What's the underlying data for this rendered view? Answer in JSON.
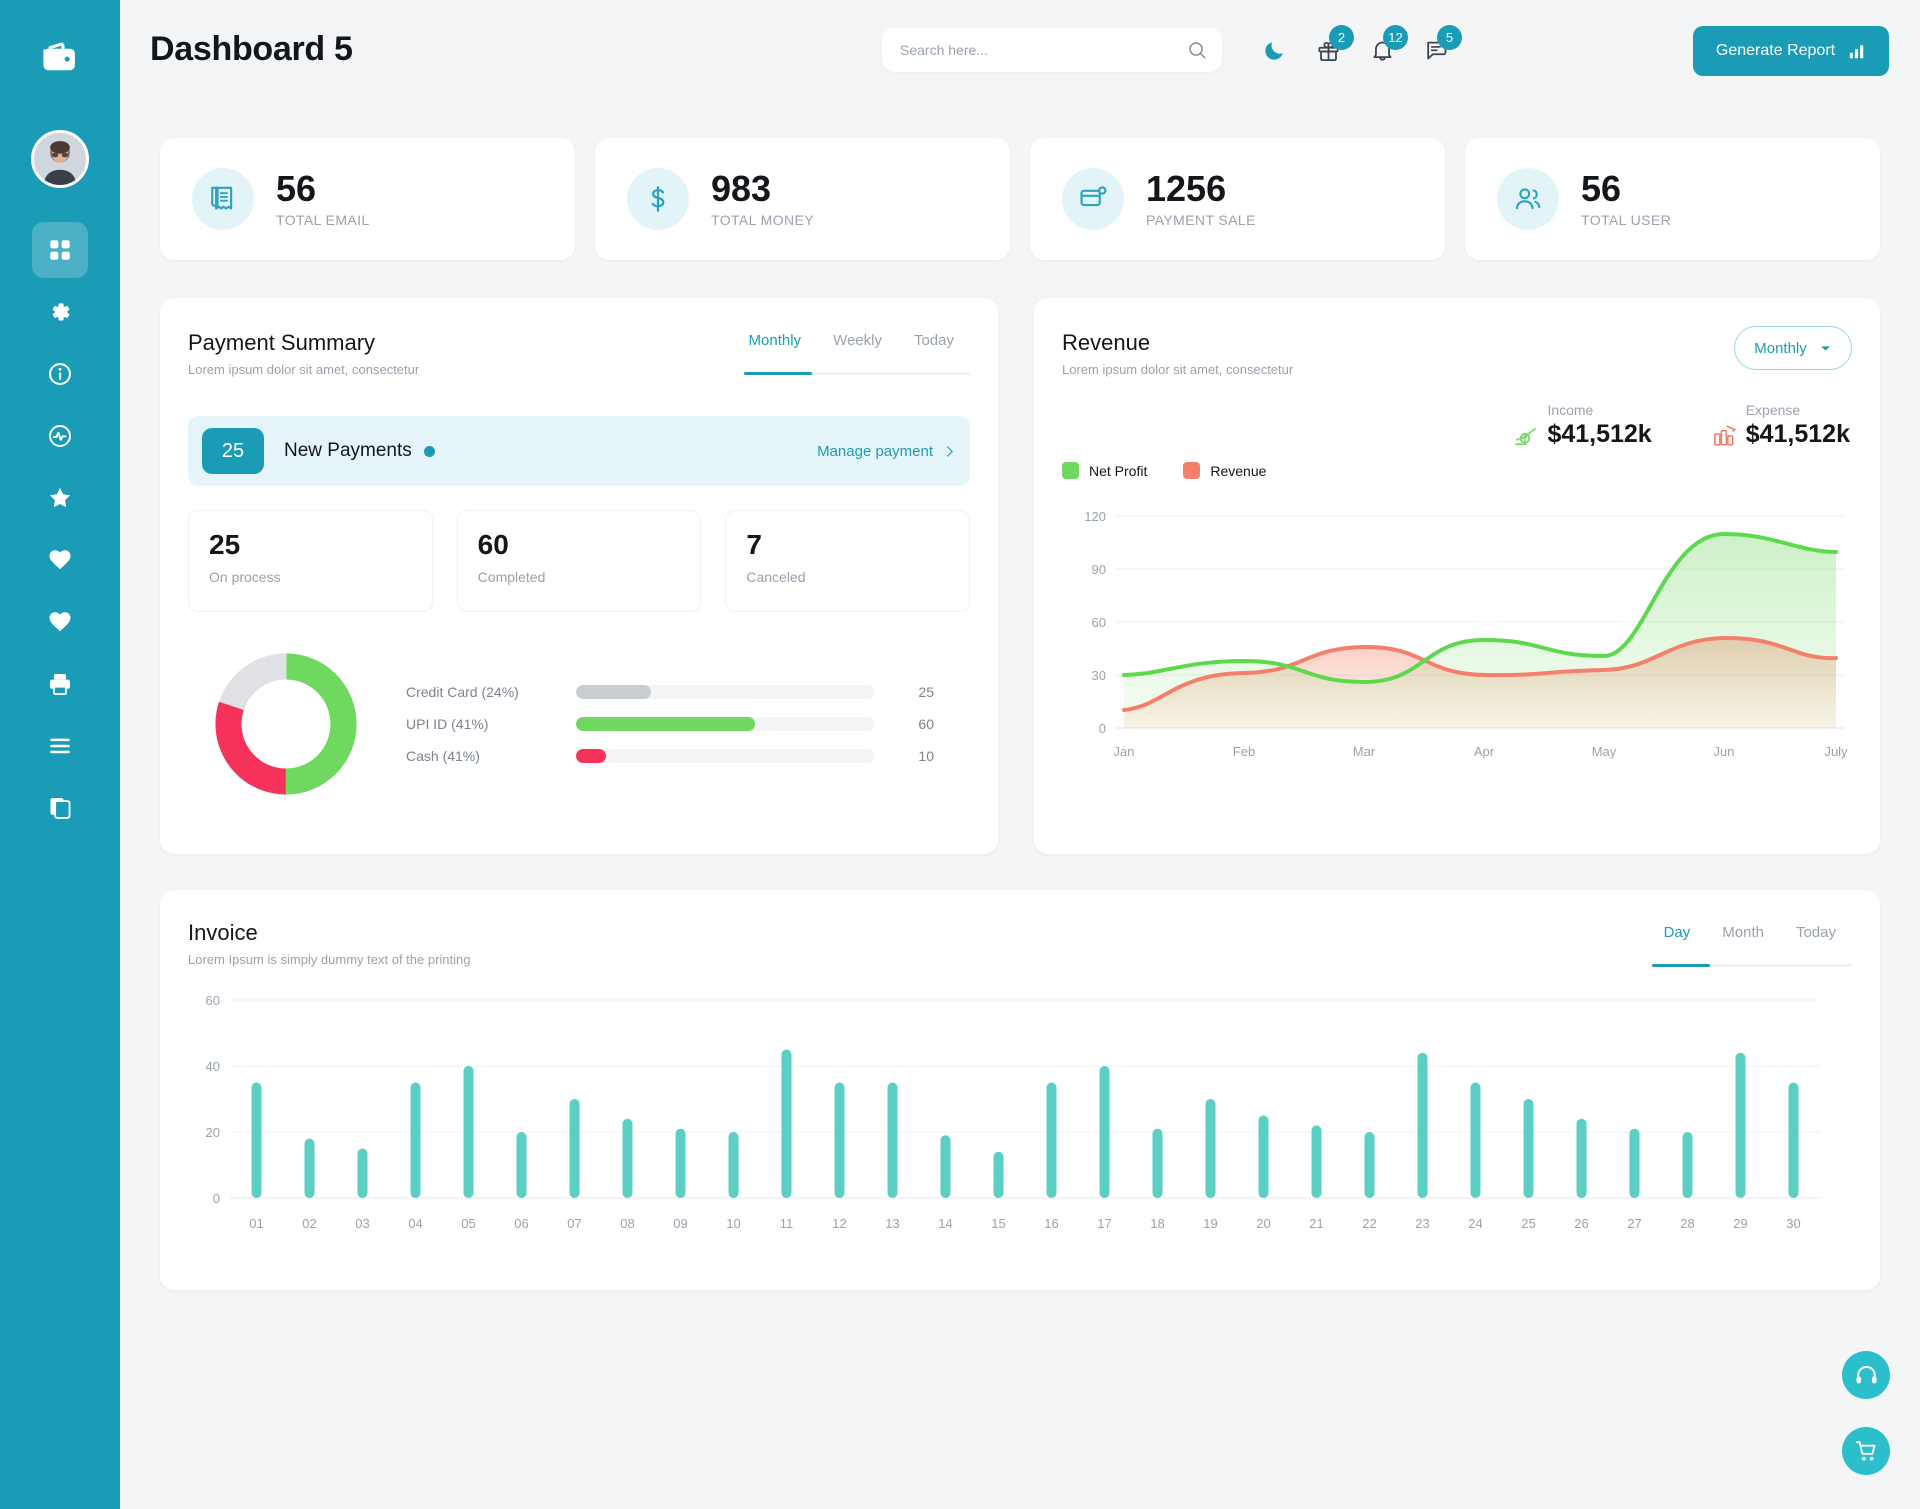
{
  "brand": {
    "logo_icon": "wallet-icon"
  },
  "header": {
    "title": "Dashboard 5",
    "search": {
      "placeholder": "Search here...",
      "value": ""
    },
    "icons": [
      {
        "name": "moon-icon",
        "badge": ""
      },
      {
        "name": "gift-icon",
        "badge": "2"
      },
      {
        "name": "bell-icon",
        "badge": "12"
      },
      {
        "name": "message-icon",
        "badge": "5"
      }
    ],
    "generate_button": {
      "label": "Generate Report",
      "icon": "bar-chart-icon",
      "color": "#1a9cb7"
    }
  },
  "sidebar": {
    "bg_color": "#1a9cb7",
    "items": [
      {
        "name": "dashboard-icon",
        "active": true
      },
      {
        "name": "gear-icon",
        "active": false
      },
      {
        "name": "info-icon",
        "active": false
      },
      {
        "name": "activity-icon",
        "active": false
      },
      {
        "name": "star-icon",
        "active": false
      },
      {
        "name": "heart-icon",
        "active": false
      },
      {
        "name": "heart-outline-icon",
        "active": false
      },
      {
        "name": "printer-icon",
        "active": false
      },
      {
        "name": "list-icon",
        "active": false
      },
      {
        "name": "copy-icon",
        "active": false
      }
    ]
  },
  "stats": [
    {
      "value": "56",
      "label": "TOTAL EMAIL",
      "icon": "receipt-icon"
    },
    {
      "value": "983",
      "label": "TOTAL MONEY",
      "icon": "dollar-icon"
    },
    {
      "value": "1256",
      "label": "PAYMENT SALE",
      "icon": "card-icon"
    },
    {
      "value": "56",
      "label": "TOTAL USER",
      "icon": "users-icon"
    }
  ],
  "payment_summary": {
    "title": "Payment Summary",
    "subtitle": "Lorem ipsum dolor sit amet, consectetur",
    "tabs": [
      {
        "label": "Monthly",
        "active": true
      },
      {
        "label": "Weekly",
        "active": false
      },
      {
        "label": "Today",
        "active": false
      }
    ],
    "new_payments": {
      "count": "25",
      "label": "New Payments",
      "action": "Manage payment"
    },
    "mini_stats": [
      {
        "value": "25",
        "label": "On process"
      },
      {
        "value": "60",
        "label": "Completed"
      },
      {
        "value": "7",
        "label": "Canceled"
      }
    ],
    "chart_data": {
      "type": "pie",
      "title": "Payment methods breakdown",
      "labels": [
        "Credit Card (24%)",
        "UPI ID (41%)",
        "Cash (41%)"
      ],
      "values": [
        25,
        60,
        10
      ],
      "percents": [
        24,
        41,
        41
      ],
      "colors": [
        "#c9cdd2",
        "#6fd85f",
        "#f5335a"
      ],
      "donut_segments": [
        {
          "name": "UPI ID",
          "sweep_deg": 180,
          "color": "#6fd85f"
        },
        {
          "name": "Cash",
          "sweep_deg": 110,
          "color": "#f5335a"
        },
        {
          "name": "Credit Card",
          "sweep_deg": 70,
          "color": "#dfe1e4"
        }
      ],
      "bar_max": 100,
      "bar_widths_pct": [
        25,
        60,
        10
      ]
    }
  },
  "revenue": {
    "title": "Revenue",
    "subtitle": "Lorem ipsum dolor sit amet, consectetur",
    "select": {
      "value": "Monthly",
      "icon": "chevron-down-icon"
    },
    "income": {
      "label": "Income",
      "value": "$41,512k",
      "icon": "money-up-icon",
      "color": "#6fd85f"
    },
    "expense": {
      "label": "Expense",
      "value": "$41,512k",
      "icon": "money-down-icon",
      "color": "#f4806b"
    },
    "chart_data": {
      "type": "area",
      "title": "Revenue",
      "x": [
        "Jan",
        "Feb",
        "Mar",
        "Apr",
        "May",
        "Jun",
        "July"
      ],
      "xlabel": "",
      "ylabel": "",
      "ylim": [
        0,
        120
      ],
      "yticks": [
        0,
        30,
        60,
        90,
        120
      ],
      "grid": true,
      "legend_position": "top-left",
      "series": [
        {
          "name": "Net Profit",
          "color": "#5ed94e",
          "values": [
            30,
            38,
            26,
            50,
            41,
            110,
            100
          ]
        },
        {
          "name": "Revenue",
          "color": "#f4806b",
          "values": [
            10,
            31,
            46,
            31,
            33,
            51,
            40
          ]
        }
      ]
    }
  },
  "invoice": {
    "title": "Invoice",
    "subtitle": "Lorem Ipsum is simply dummy text of the printing",
    "tabs": [
      {
        "label": "Day",
        "active": true
      },
      {
        "label": "Month",
        "active": false
      },
      {
        "label": "Today",
        "active": false
      }
    ],
    "chart_data": {
      "type": "bar",
      "title": "Invoice",
      "categories": [
        "01",
        "02",
        "03",
        "04",
        "05",
        "06",
        "07",
        "08",
        "09",
        "10",
        "11",
        "12",
        "13",
        "14",
        "15",
        "16",
        "17",
        "18",
        "19",
        "20",
        "21",
        "22",
        "23",
        "24",
        "25",
        "26",
        "27",
        "28",
        "29",
        "30"
      ],
      "values": [
        35,
        18,
        15,
        35,
        40,
        20,
        30,
        24,
        21,
        20,
        45,
        35,
        35,
        19,
        14,
        35,
        40,
        21,
        30,
        25,
        22,
        20,
        44,
        35,
        30,
        24,
        21,
        20,
        44,
        35
      ],
      "series": [
        {
          "name": "Invoice",
          "color": "#5bcfc4",
          "values": [
            35,
            18,
            15,
            35,
            40,
            20,
            30,
            24,
            21,
            20,
            45,
            35,
            35,
            19,
            14,
            35,
            40,
            21,
            30,
            25,
            22,
            20,
            44,
            35,
            30,
            24,
            21,
            20,
            44,
            35
          ]
        }
      ],
      "xlabel": "",
      "ylabel": "",
      "ylim": [
        0,
        60
      ],
      "yticks": [
        0,
        20,
        40,
        60
      ],
      "grid": true,
      "bar_color": "#5bcfc4"
    }
  },
  "floating_actions": [
    {
      "name": "support-icon",
      "color": "#2bbecb"
    },
    {
      "name": "cart-icon",
      "color": "#2bbecb"
    }
  ]
}
